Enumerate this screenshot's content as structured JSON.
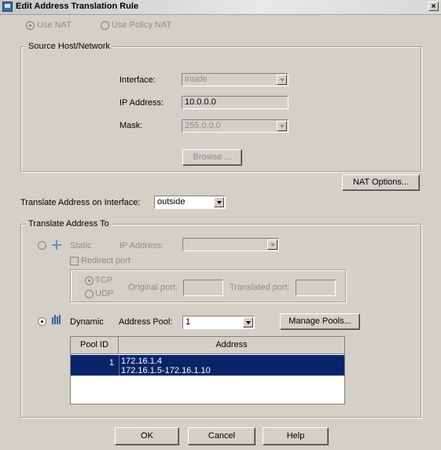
{
  "window": {
    "title": "Edit Address Translation Rule",
    "close_glyph": "×"
  },
  "nat_mode": {
    "use_nat_label": "Use NAT",
    "use_policy_nat_label": "Use Policy NAT",
    "selected": "use_nat"
  },
  "source": {
    "legend": "Source Host/Network",
    "interface_label": "Interface:",
    "interface_value": "inside",
    "ip_label": "IP Address:",
    "ip_value": "10.0.0.0",
    "mask_label": "Mask:",
    "mask_value": "255.0.0.0",
    "browse_label": "Browse ..."
  },
  "nat_options_label": "NAT Options...",
  "translate_interface": {
    "label": "Translate Address on Interface:",
    "value": "outside"
  },
  "translate_to": {
    "legend": "Translate Address To",
    "static": {
      "label": "Static",
      "ip_label": "IP Address:",
      "ip_value": "",
      "redirect_label": "Redirect port",
      "tcp_label": "TCP",
      "udp_label": "UDP",
      "original_port_label": "Original port:",
      "original_port_value": "",
      "translated_port_label": "Translated port:",
      "translated_port_value": ""
    },
    "dynamic": {
      "label": "Dynamic",
      "pool_label": "Address Pool:",
      "pool_value": "1",
      "manage_pools_label": "Manage Pools..."
    },
    "selected": "dynamic"
  },
  "pool_table": {
    "headers": [
      "Pool ID",
      "Address"
    ],
    "rows": [
      {
        "pool_id": "1",
        "addresses": [
          "172.16.1.4",
          "172.16.1.5-172.16.1.10"
        ]
      }
    ]
  },
  "buttons": {
    "ok": "OK",
    "cancel": "Cancel",
    "help": "Help"
  },
  "colors": {
    "window_bg": "#d4d0c8",
    "selection": "#0a246a",
    "disabled_text": "#8c8c8c"
  }
}
